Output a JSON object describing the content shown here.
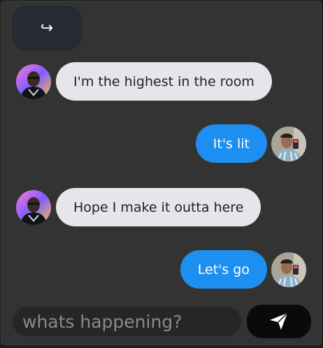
{
  "toolbar": {
    "redirect_icon": "↪"
  },
  "messages": [
    {
      "direction": "incoming",
      "text": "I'm the highest in the room",
      "avatar": "avatar-bald-man"
    },
    {
      "direction": "outgoing",
      "text": "It's lit",
      "avatar": "avatar-selfie-man"
    },
    {
      "direction": "incoming",
      "text": "Hope I make it outta here",
      "avatar": "avatar-bald-man"
    },
    {
      "direction": "outgoing",
      "text": "Let's go",
      "avatar": "avatar-selfie-man"
    }
  ],
  "composer": {
    "placeholder": "whats happening?",
    "value": ""
  },
  "send": {
    "icon": "send-icon"
  },
  "colors": {
    "background": "#333333",
    "incoming_bubble": "#e6e6ea",
    "outgoing_bubble": "#1d8ff0",
    "send_button": "#0a0a0a"
  }
}
